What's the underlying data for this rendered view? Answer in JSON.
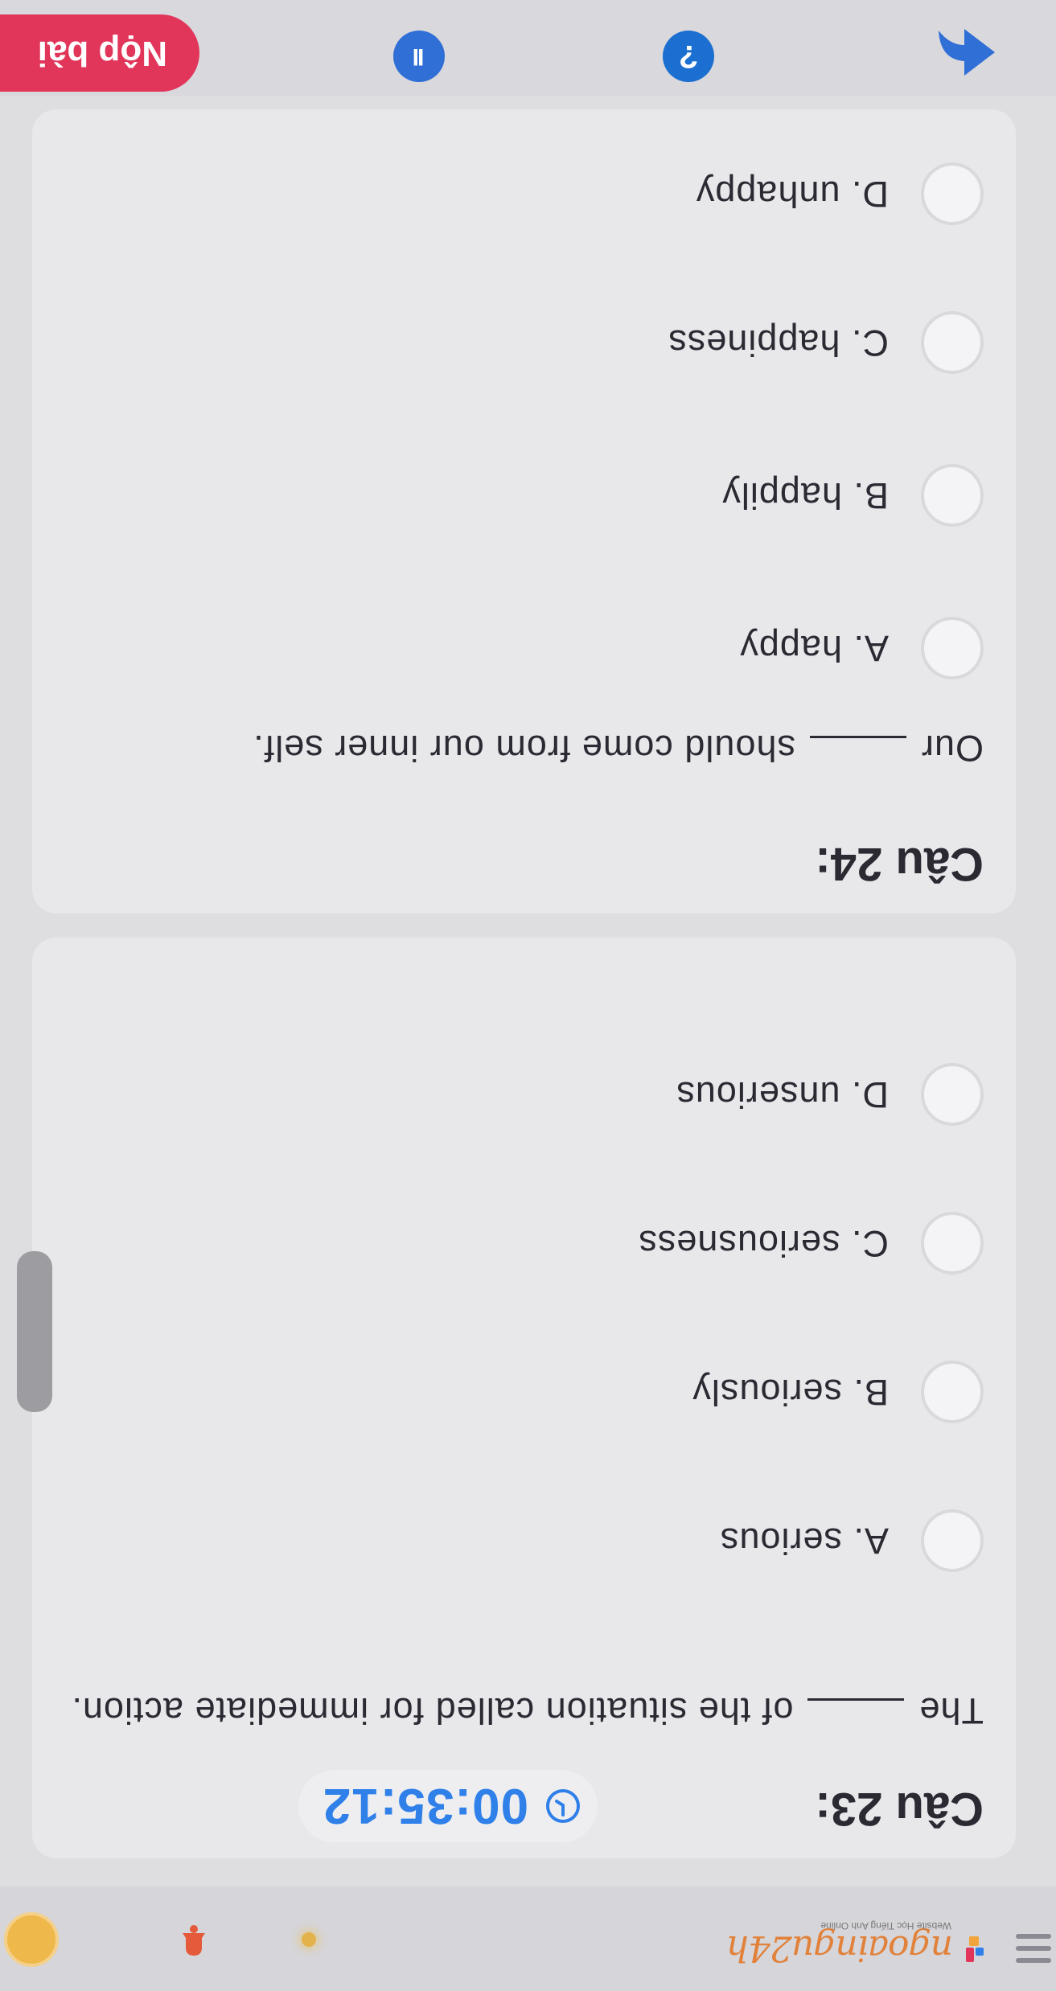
{
  "header": {
    "logo_text": "ngoaingu24h",
    "logo_subtitle": "Website Học Tiếng Anh Online",
    "menu_icon": "hamburger-icon",
    "bell_icon": "bell-icon",
    "avatar_icon": "avatar"
  },
  "timer": {
    "icon": "clock-icon",
    "value": "00:35:12",
    "color": "#2f80e8"
  },
  "questions": [
    {
      "title": "Câu 23:",
      "text_before": "The",
      "text_after": "of the situation called for immediate action.",
      "options": [
        "A. serious",
        "B. seriously",
        "C. seriousness",
        "D. unserious"
      ]
    },
    {
      "title": "Câu 24:",
      "text_before": "Our",
      "text_after": "should come from our inner self.",
      "options": [
        "A. happy",
        "B. happily",
        "C. happiness",
        "D. unhappy"
      ]
    }
  ],
  "toolbar": {
    "back_icon": "back-arrow-icon",
    "help_label": "?",
    "pause_label": "II",
    "submit_label": "Nộp bài",
    "submit_color": "#e1355a"
  }
}
